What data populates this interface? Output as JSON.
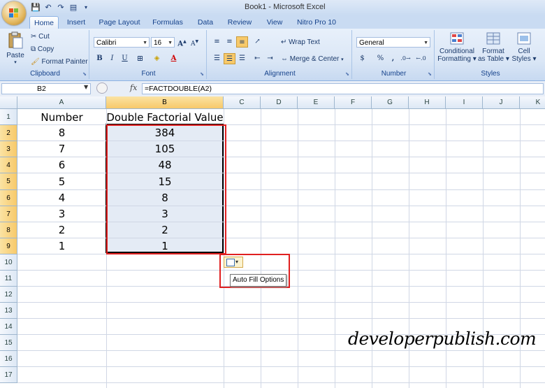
{
  "window": {
    "title": "Book1 - Microsoft Excel"
  },
  "tabs": [
    {
      "label": "Home",
      "active": true
    },
    {
      "label": "Insert"
    },
    {
      "label": "Page Layout"
    },
    {
      "label": "Formulas"
    },
    {
      "label": "Data"
    },
    {
      "label": "Review"
    },
    {
      "label": "View"
    },
    {
      "label": "Nitro Pro 10"
    }
  ],
  "ribbon": {
    "clipboard": {
      "label": "Clipboard",
      "paste": "Paste",
      "cut": "Cut",
      "copy": "Copy",
      "format_painter": "Format Painter"
    },
    "font": {
      "label": "Font",
      "font_name": "Calibri",
      "font_size": "16",
      "bold": "B",
      "italic": "I",
      "underline": "U"
    },
    "alignment": {
      "label": "Alignment",
      "wrap_text": "Wrap Text",
      "merge_center": "Merge & Center"
    },
    "number": {
      "label": "Number",
      "format": "General",
      "currency": "$",
      "percent": "%",
      "comma": ","
    },
    "styles": {
      "label": "Styles",
      "conditional_1": "Conditional",
      "conditional_2": "Formatting",
      "format_table_1": "Format",
      "format_table_2": "as Table",
      "cell_styles_1": "Cell",
      "cell_styles_2": "Styles"
    }
  },
  "formula_bar": {
    "name_box": "B2",
    "fx": "fx",
    "formula": "=FACTDOUBLE(A2)"
  },
  "sheet": {
    "columns": [
      "A",
      "B",
      "C",
      "D",
      "E",
      "F",
      "G",
      "H",
      "I",
      "J",
      "K"
    ],
    "rows": [
      "1",
      "2",
      "3",
      "4",
      "5",
      "6",
      "7",
      "8",
      "9",
      "10",
      "11",
      "12",
      "13",
      "14",
      "15",
      "16",
      "17"
    ],
    "header_a": "Number",
    "header_b": "Double Factorial Value",
    "col_a": [
      "8",
      "7",
      "6",
      "5",
      "4",
      "3",
      "2",
      "1"
    ],
    "col_b": [
      "384",
      "105",
      "48",
      "15",
      "8",
      "3",
      "2",
      "1"
    ]
  },
  "auto_fill": {
    "tooltip": "Auto Fill Options"
  },
  "watermark": "developerpublish.com",
  "colors": {
    "highlight_red": "#e02020",
    "selection": "#e4ebf5",
    "header_selected": "#f7c96a"
  }
}
